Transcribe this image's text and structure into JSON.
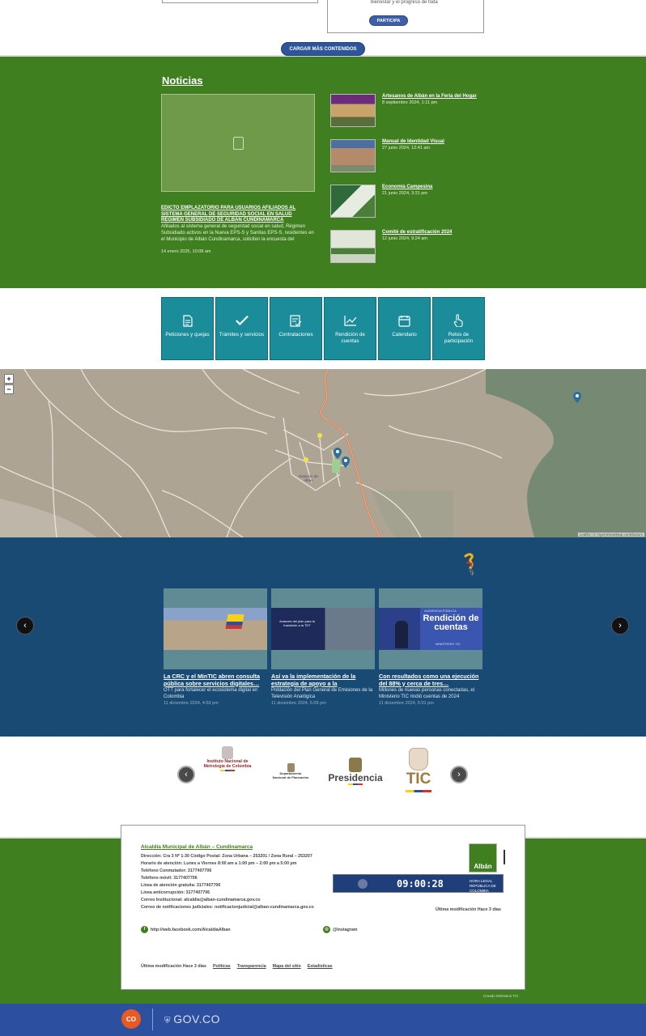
{
  "top": {
    "cut_text": "bienestar y el progreso de toda",
    "participa_label": "PARTICIPA",
    "load_more_label": "CARGAR MÁS CONTENIDOS"
  },
  "news": {
    "section_title": "Noticias",
    "main": {
      "title": "EDICTO EMPLAZATORIO PARA USUARIOS AFILIADOS AL SISTEMA GENERAL DE SEGURIDAD SOCIAL EN SALUD REGIMEN SUBSIDIADO DE ALBAN CUNDINAMARCA",
      "description": "Afiliados al sistema general de seguridad social en salud, Régimen Subsidiado activos en la Nueva EPS-S y Sanitas EPS-S, residentes en el Municipio de Albán Cundinamarca, soliciten la encuesta del",
      "date": "14 enero 2025, 10:08 am"
    },
    "items": [
      {
        "title": "Artesanos de Albán en la Feria del Hogar",
        "date": "8 septiembre 2024, 1:11 pm"
      },
      {
        "title": "Manual de Identidad Visual",
        "date": "27 junio 2024, 12:41 am"
      },
      {
        "title": "Economía Campesina",
        "date": "21 junio 2024, 3:31 pm"
      },
      {
        "title": "Comité de estratificación 2024",
        "date": "12 junio 2024, 9:24 am"
      }
    ]
  },
  "quick_links": [
    {
      "label": "Peticiones y quejas",
      "icon": "document-icon"
    },
    {
      "label": "Trámites y servicios",
      "icon": "check-icon"
    },
    {
      "label": "Contrataciones",
      "icon": "clipboard-check-icon"
    },
    {
      "label": "Rendición de cuentas",
      "icon": "chart-line-icon"
    },
    {
      "label": "Calendario",
      "icon": "calendar-icon"
    },
    {
      "label": "Retos de participación",
      "icon": "hand-pointer-icon"
    }
  ],
  "map": {
    "zoom_in": "+",
    "zoom_out": "−",
    "attribution": "Leaflet | © OpenStreetMap contributors",
    "place_label": "Estación de Albán"
  },
  "mintic": {
    "cards": [
      {
        "title": "La CRC y el MinTIC abren consulta pública sobre servicios digitales…",
        "description": "OTT para fortalecer el ecosistema digital en Colombia",
        "date": "11 diciembre 2024, 4:59 pm"
      },
      {
        "title": "Así va la implementación de la estrategia de apoyo a la",
        "description": "Población del Plan General de Emisiones de la Televisión Analógica",
        "date": "11 diciembre 2024, 5:09 pm"
      },
      {
        "title": "Con resultados como una ejecución del 88% y cerca de tres…",
        "description": "Millones de nuevas personas conectadas, el Ministerio TIC rindió cuentas de 2024",
        "date": "11 diciembre 2024, 5:01 pm"
      }
    ],
    "card2_overlay": "Avances del plan para la transición a la TDT",
    "card3_overlay_top": "AUDIENCIA PÚBLICA",
    "card3_overlay_main": "Rendición de cuentas",
    "card3_overlay_sub": "MINISTERIO TIC"
  },
  "logos": {
    "inm_line1": "Instituto Nacional de",
    "inm_line2": "Metrología de Colombia",
    "dnp_line1": "Departamento",
    "dnp_line2": "Nacional de Planeación",
    "presidencia": "Presidencia",
    "tic": "TIC"
  },
  "footer": {
    "heading": "Alcaldía Municipal de Albán – Cundinamarca",
    "lines": [
      "Dirección: Cra 3 Nº 1-30 Código Postal: Zona Urbana – 253201 / Zona Rural – 253207",
      "Horario de atención: Lunes a Viernes 8:00 am a 1:00 pm – 2:00 pm a 5:00 pm",
      "Teléfono Conmutador: 3177407706",
      "Teléfono móvil: 3177407706",
      "Línea de atención gratuita: 3177407706",
      "Línea anticorrupción: 3177407706",
      "Correo Institucional: alcaldia@alban-cundinamarca.gov.co",
      "Correo de notificaciones judiciales: notificacionjudicial@alban-cundinamarca.gov.co"
    ],
    "clock_time": "09:00:28",
    "clock_label_1": "HORA LEGAL",
    "clock_label_2": "REPÚBLICA DE COLOMBIA",
    "last_modified_right": "Última modificación Hace 3 días",
    "facebook": "http://web.facebook.com/AlcaldiaAlban",
    "instagram": "@Instagram",
    "last_modified_bottom": "Última modificación Hace 3 días",
    "links": [
      "Políticas",
      "Transparencia",
      "Mapa del sitio",
      "Estadísticas"
    ],
    "logo_text": "Albán",
    "created_by": "Creado Ministerio TIC"
  },
  "gov": {
    "co_label": "CO",
    "gov_label": "GOV.CO"
  }
}
